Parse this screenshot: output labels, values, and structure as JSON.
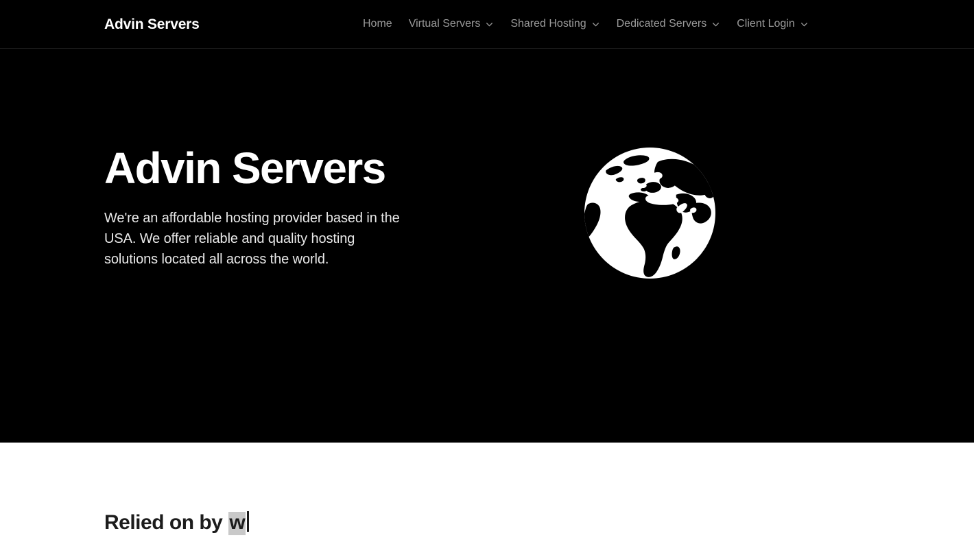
{
  "header": {
    "brand": "Advin Servers",
    "nav": [
      {
        "label": "Home",
        "has_dropdown": false,
        "icon": ""
      },
      {
        "label": "Virtual Servers",
        "has_dropdown": true,
        "icon": "chevron-down-icon"
      },
      {
        "label": "Shared Hosting",
        "has_dropdown": true,
        "icon": "chevron-down-icon"
      },
      {
        "label": "Dedicated Servers",
        "has_dropdown": true,
        "icon": "chevron-down-icon"
      },
      {
        "label": "Client Login",
        "has_dropdown": true,
        "icon": "chevron-down-icon"
      }
    ]
  },
  "hero": {
    "title": "Advin Servers",
    "subtitle": "We're an affordable hosting provider based in the USA. We offer reliable and quality hosting solutions located all across the world.",
    "illustration": "globe-icon"
  },
  "relied_section": {
    "static_text": "Relied on by",
    "typed_text": "w",
    "caret": "text-cursor"
  },
  "colors": {
    "hero_background": "#000000",
    "header_background": "#000000",
    "header_border": "#1e1e1e",
    "section_background": "#ffffff",
    "nav_text": "#9b9b9b",
    "hero_title": "#ffffff",
    "hero_subtitle": "#e9e9e9",
    "heading_text": "#1c1c1c",
    "typed_highlight": "#c9c9c9",
    "globe_fill": "#ffffff",
    "globe_land": "#000000"
  }
}
